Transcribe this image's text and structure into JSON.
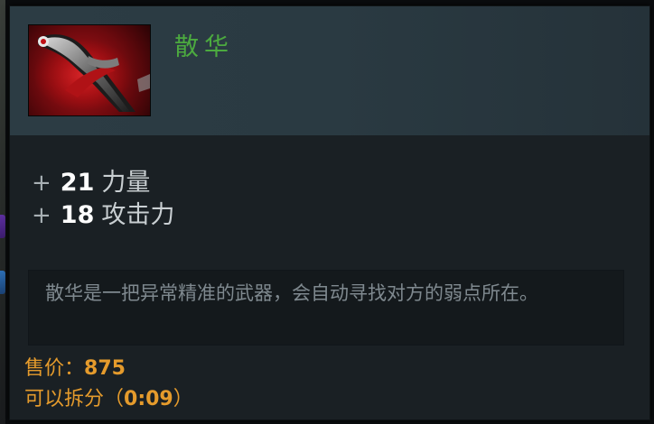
{
  "item": {
    "icon": "dagger-icon",
    "name": "散华"
  },
  "stats": [
    {
      "sign": "+",
      "value": "21",
      "label": "力量"
    },
    {
      "sign": "+",
      "value": "18",
      "label": "攻击力"
    }
  ],
  "lore": "散华是一把异常精准的武器，会自动寻找对方的弱点所在。",
  "sell": {
    "label": "售价：",
    "value": "875"
  },
  "disassemble": {
    "label": "可以拆分（",
    "value": "0:09",
    "suffix": "）"
  },
  "colors": {
    "name": "#4caa3f",
    "gold": "#e59b2c",
    "lore": "#7f898f",
    "panel": "#1b2226",
    "header": "#2c3c44"
  }
}
